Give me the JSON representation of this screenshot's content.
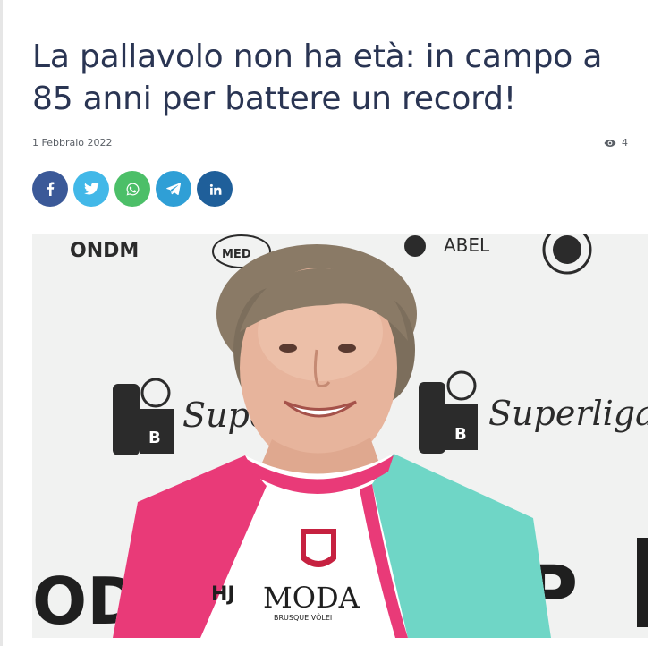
{
  "article": {
    "title": "La pallavolo non ha età: in campo a 85 anni per battere un record!",
    "date": "1 Febbraio 2022",
    "views": "4"
  },
  "share": [
    {
      "name": "facebook",
      "icon": "facebook-icon",
      "color": "#3b5998"
    },
    {
      "name": "twitter",
      "icon": "twitter-icon",
      "color": "#42b8e8"
    },
    {
      "name": "whatsapp",
      "icon": "whatsapp-icon",
      "color": "#4cbf68"
    },
    {
      "name": "telegram",
      "icon": "telegram-icon",
      "color": "#2f9fd6"
    },
    {
      "name": "linkedin",
      "icon": "linkedin-icon",
      "color": "#1f5f9a"
    }
  ],
  "photo": {
    "backdrop_logos": [
      "ONDM",
      "CONSUL MED",
      "ABEL",
      "Superliga",
      "Superliga"
    ],
    "jersey_text": [
      "MODA",
      "BRUSQUE VÔLEI"
    ],
    "colors": {
      "pink": "#e93a78",
      "teal": "#6fd6c6",
      "backdrop": "#f3f3f3"
    }
  }
}
